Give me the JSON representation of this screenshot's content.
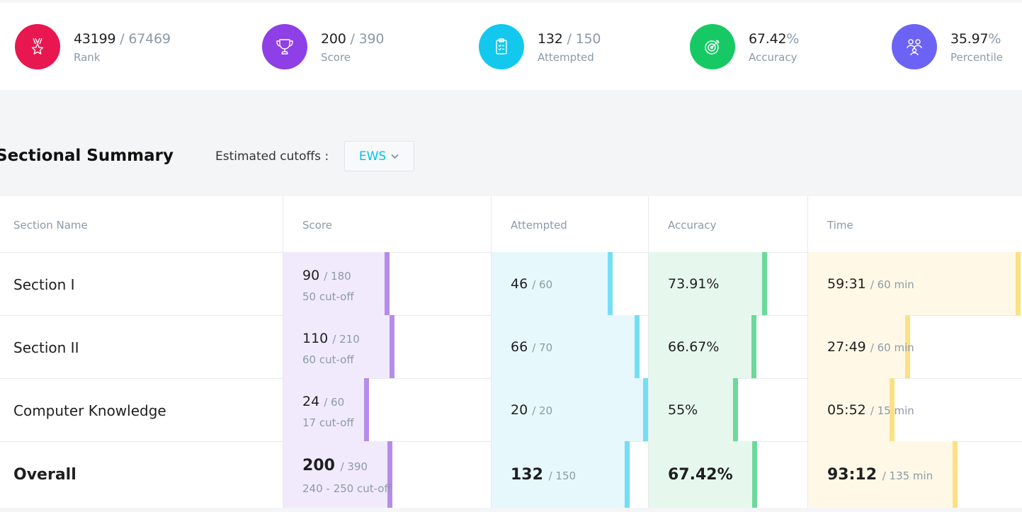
{
  "stats": [
    {
      "value": "43199",
      "total": "67469",
      "label": "Rank",
      "color": "#e8174f",
      "icon": "medal-star-icon"
    },
    {
      "value": "200",
      "total": "390",
      "label": "Score",
      "color": "#8e3fe6",
      "icon": "trophy-icon"
    },
    {
      "value": "132",
      "total": "150",
      "label": "Attempted",
      "color": "#12c8ee",
      "icon": "checklist-icon"
    },
    {
      "value": "67.42",
      "unit": "%",
      "label": "Accuracy",
      "color": "#17c964",
      "icon": "target-icon"
    },
    {
      "value": "35.97",
      "unit": "%",
      "label": "Percentile",
      "color": "#6c63f5",
      "icon": "people-icon"
    }
  ],
  "summary": {
    "title": "Sectional Summary",
    "cutoff_label": "Estimated cutoffs :",
    "cutoff_selected": "EWS",
    "columns": [
      "Section Name",
      "Score",
      "Attempted",
      "Accuracy",
      "Time"
    ]
  },
  "rows": [
    {
      "name": "Section I",
      "score": "90",
      "score_max": "/ 180",
      "cutoff": "50 cut-off",
      "attempted": "46",
      "attempted_max": "/ 60",
      "accuracy": "73.91%",
      "time": "59:31",
      "time_max": "/ 60 min",
      "score_frac": 0.5,
      "attempt_frac": 0.767,
      "acc_frac": 0.739,
      "time_frac": 0.992
    },
    {
      "name": "Section II",
      "score": "110",
      "score_max": "/ 210",
      "cutoff": "60 cut-off",
      "attempted": "66",
      "attempted_max": "/ 70",
      "accuracy": "66.67%",
      "time": "27:49",
      "time_max": "/ 60 min",
      "score_frac": 0.524,
      "attempt_frac": 0.943,
      "acc_frac": 0.667,
      "time_frac": 0.464
    },
    {
      "name": "Computer Knowledge",
      "score": "24",
      "score_max": "/ 60",
      "cutoff": "17 cut-off",
      "attempted": "20",
      "attempted_max": "/ 20",
      "accuracy": "55%",
      "time": "05:52",
      "time_max": "/ 15 min",
      "score_frac": 0.4,
      "attempt_frac": 1.0,
      "acc_frac": 0.55,
      "time_frac": 0.391
    },
    {
      "name": "Overall",
      "score": "200",
      "score_max": "/ 390",
      "cutoff": "240 - 250 cut-off",
      "attempted": "132",
      "attempted_max": "/ 150",
      "accuracy": "67.42%",
      "time": "93:12",
      "time_max": "/ 135 min",
      "score_frac": 0.513,
      "attempt_frac": 0.88,
      "acc_frac": 0.674,
      "time_frac": 0.69
    }
  ],
  "theme": {
    "score_fill": "#f1eafc",
    "score_bar": "#b58de8",
    "attempt_fill": "#e6f8fc",
    "attempt_bar": "#74def2",
    "acc_fill": "#e6f8ee",
    "acc_bar": "#6bd99a",
    "time_fill": "#fff8e7",
    "time_bar": "#fbe184"
  }
}
